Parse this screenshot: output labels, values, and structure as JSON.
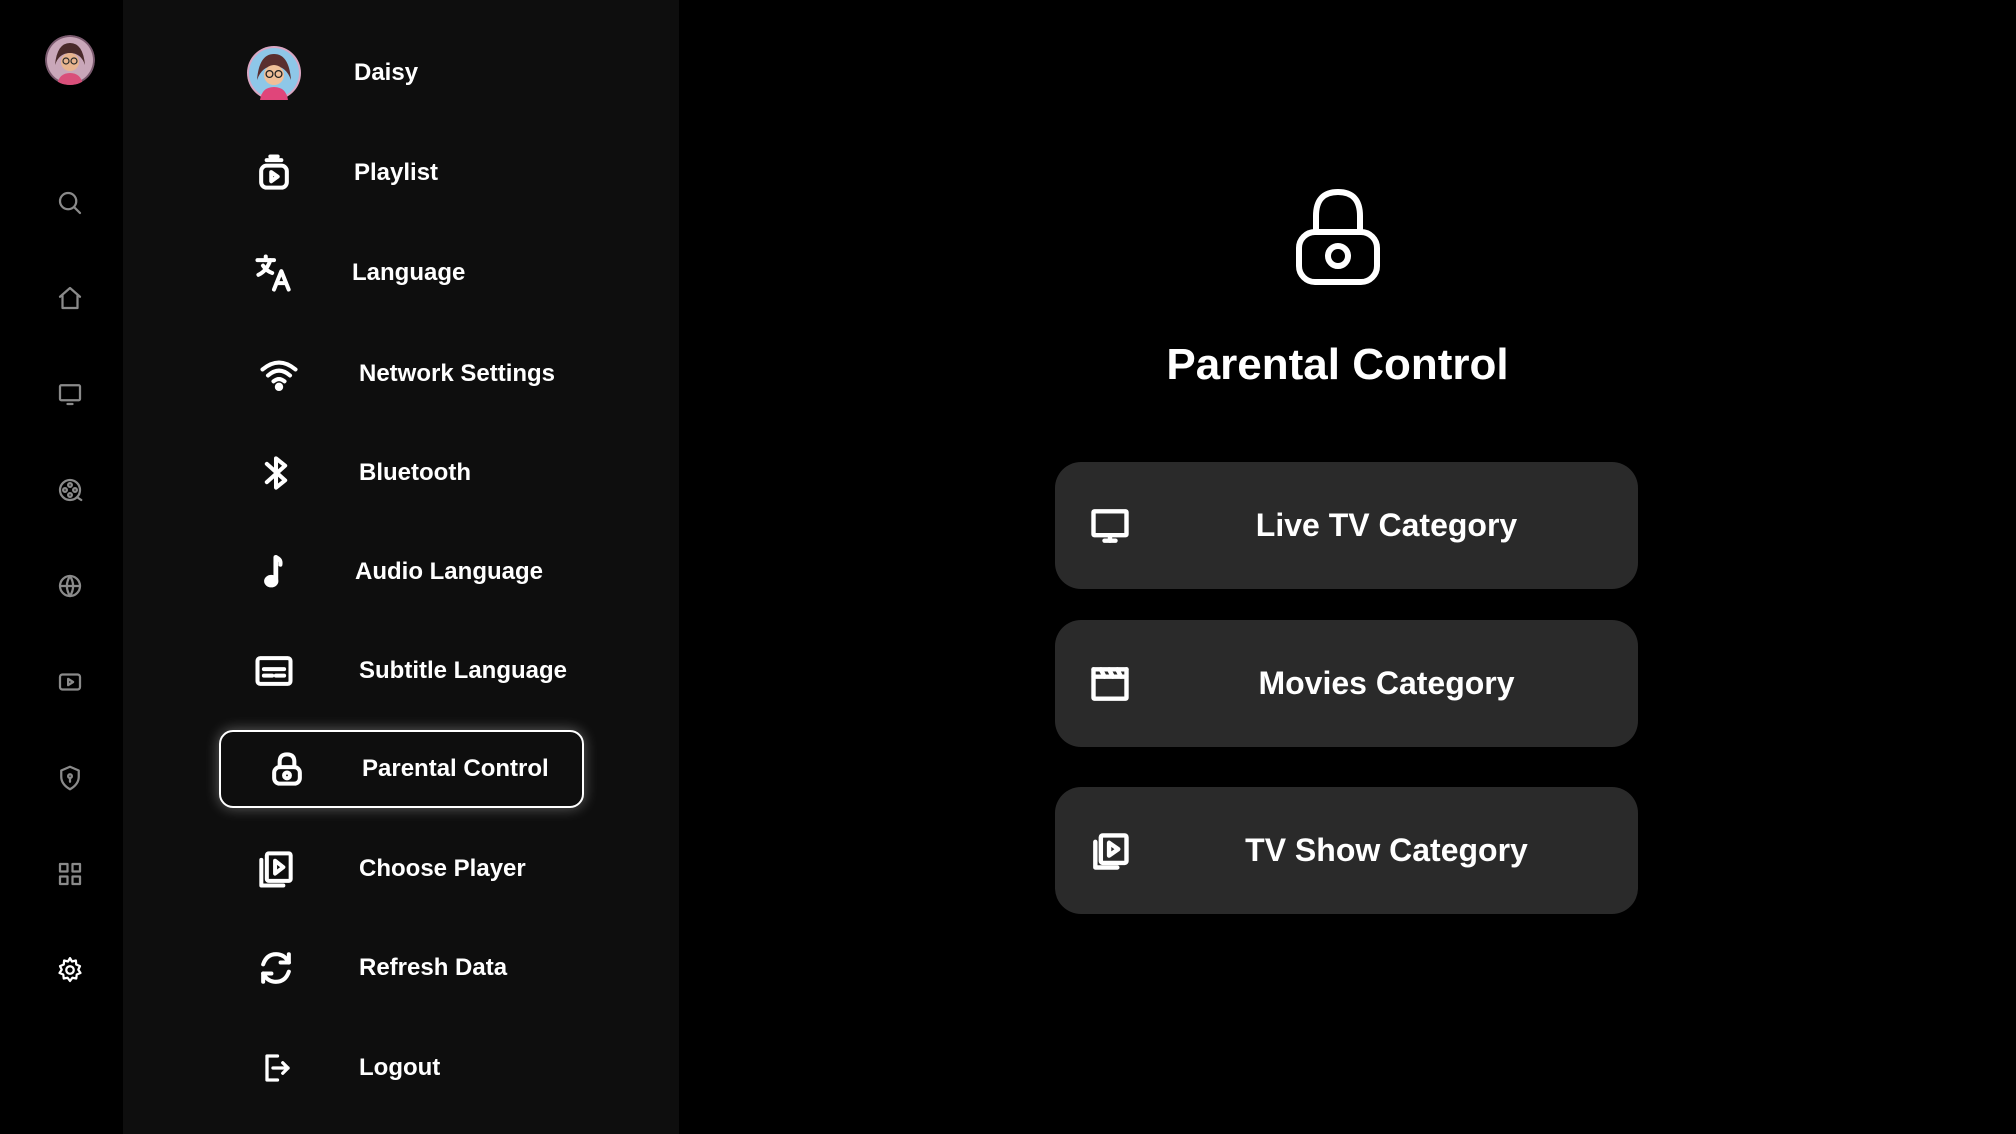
{
  "rail": {
    "icons": [
      "avatar",
      "search-icon",
      "home-icon",
      "tv-icon",
      "film-reel-icon",
      "sports-icon",
      "video-icon",
      "shield-icon",
      "grid-icon",
      "gear-icon"
    ],
    "active": "gear-icon"
  },
  "menu": {
    "items": [
      {
        "label": "Daisy",
        "icon": "avatar"
      },
      {
        "label": "Playlist",
        "icon": "playlist-icon"
      },
      {
        "label": "Language",
        "icon": "translate-icon"
      },
      {
        "label": "Network Settings",
        "icon": "wifi-icon"
      },
      {
        "label": "Bluetooth",
        "icon": "bluetooth-icon"
      },
      {
        "label": "Audio Language",
        "icon": "music-note-icon"
      },
      {
        "label": "Subtitle Language",
        "icon": "subtitles-icon"
      },
      {
        "label": "Parental Control",
        "icon": "lock-icon",
        "selected": true
      },
      {
        "label": "Choose Player",
        "icon": "player-icon"
      },
      {
        "label": "Refresh Data",
        "icon": "refresh-icon"
      },
      {
        "label": "Logout",
        "icon": "logout-icon"
      }
    ]
  },
  "main": {
    "title": "Parental Control",
    "icon": "lock-icon",
    "categories": [
      {
        "label": "Live TV Category",
        "icon": "tv-icon"
      },
      {
        "label": "Movies Category",
        "icon": "clapperboard-icon"
      },
      {
        "label": "TV Show Category",
        "icon": "tv-show-icon"
      }
    ]
  },
  "colors": {
    "background": "#000000",
    "menu_panel": "#0e0e0e",
    "button": "#2a2a2a",
    "rail_icon": "#8a8a8a",
    "text": "#ffffff"
  }
}
